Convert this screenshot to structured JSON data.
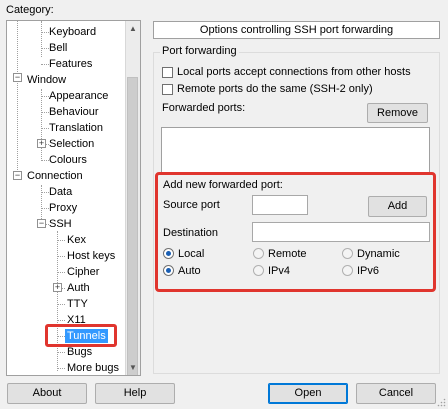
{
  "category_label": "Category:",
  "tree": {
    "items": [
      {
        "label": "Keyboard"
      },
      {
        "label": "Bell"
      },
      {
        "label": "Features"
      },
      {
        "label": "Window"
      },
      {
        "label": "Appearance"
      },
      {
        "label": "Behaviour"
      },
      {
        "label": "Translation"
      },
      {
        "label": "Selection"
      },
      {
        "label": "Colours"
      },
      {
        "label": "Connection"
      },
      {
        "label": "Data"
      },
      {
        "label": "Proxy"
      },
      {
        "label": "SSH"
      },
      {
        "label": "Kex"
      },
      {
        "label": "Host keys"
      },
      {
        "label": "Cipher"
      },
      {
        "label": "Auth"
      },
      {
        "label": "TTY"
      },
      {
        "label": "X11"
      },
      {
        "label": "Tunnels"
      },
      {
        "label": "Bugs"
      },
      {
        "label": "More bugs"
      }
    ],
    "selected": "Tunnels"
  },
  "panel_title": "Options controlling SSH port forwarding",
  "port_forwarding": {
    "group_title": "Port forwarding",
    "local_ports_label": "Local ports accept connections from other hosts",
    "local_ports_checked": false,
    "remote_ports_label": "Remote ports do the same (SSH-2 only)",
    "remote_ports_checked": false,
    "forwarded_ports_label": "Forwarded ports:",
    "remove_label": "Remove"
  },
  "add_forward": {
    "title": "Add new forwarded port:",
    "source_port_label": "Source port",
    "source_port_value": "",
    "add_label": "Add",
    "destination_label": "Destination",
    "destination_value": "",
    "direction_options": [
      "Local",
      "Remote",
      "Dynamic"
    ],
    "direction_selected": "Local",
    "protocol_options": [
      "Auto",
      "IPv4",
      "IPv6"
    ],
    "protocol_selected": "Auto"
  },
  "footer": {
    "about_label": "About",
    "help_label": "Help",
    "open_label": "Open",
    "cancel_label": "Cancel"
  },
  "colors": {
    "highlight_red": "#e0352e",
    "selection_blue": "#3399ff"
  }
}
